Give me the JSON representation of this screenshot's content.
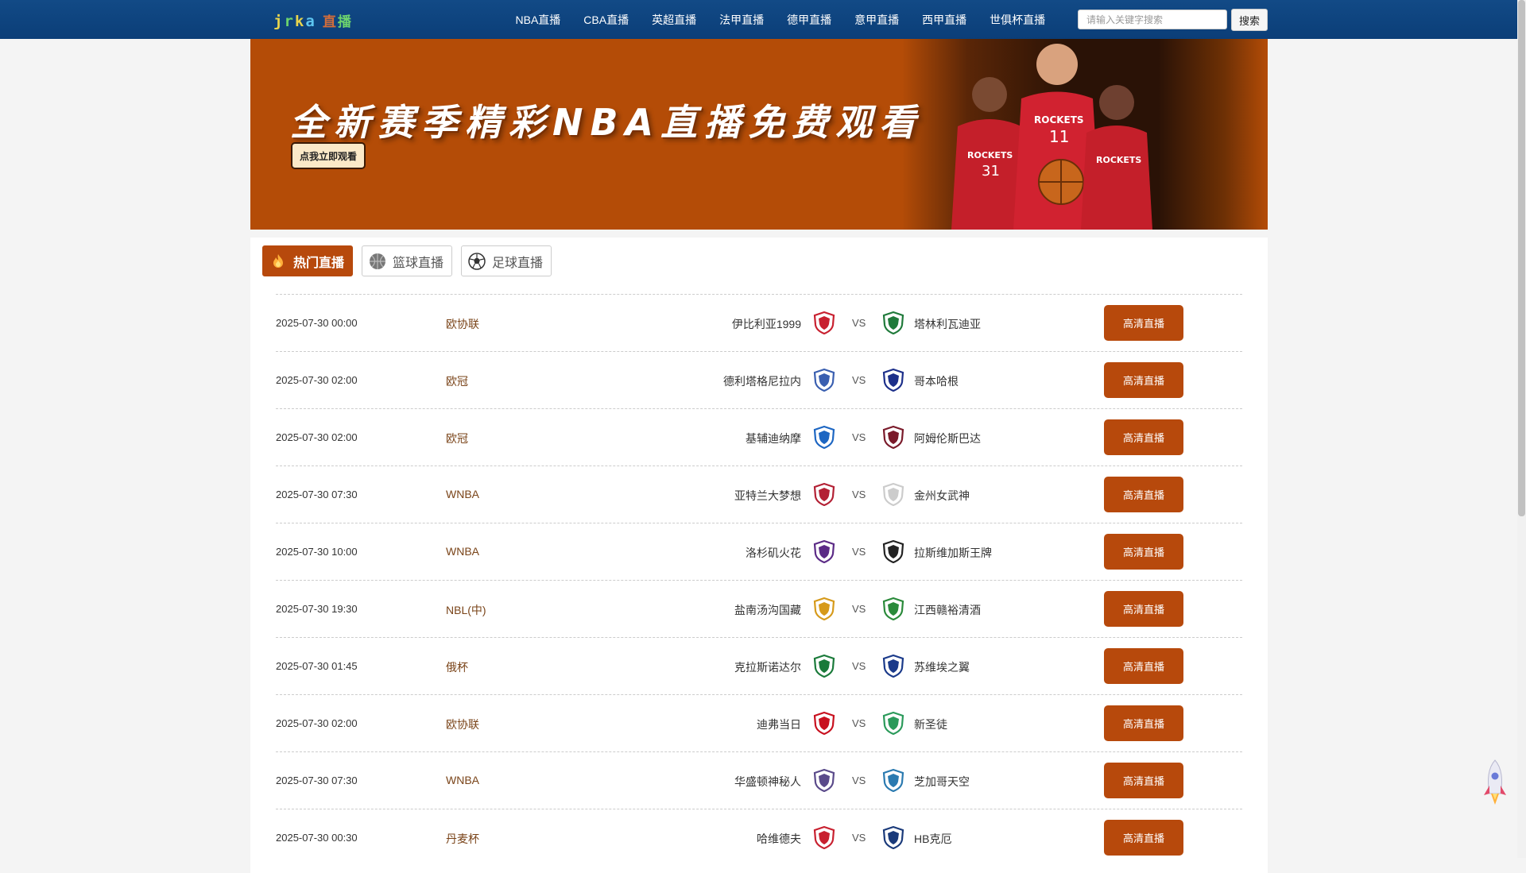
{
  "nav": {
    "logo_text": "jrkan",
    "logo_text_cn": "直播",
    "links": [
      "NBA直播",
      "CBA直播",
      "英超直播",
      "法甲直播",
      "德甲直播",
      "意甲直播",
      "西甲直播",
      "世俱杯直播"
    ],
    "search_placeholder": "请输入关键字搜索",
    "search_button": "搜索"
  },
  "banner": {
    "headline": "全新赛季精彩NBA直播免费观看",
    "cta": "点我立即观看",
    "jersey_texts": [
      "ROCKETS",
      "11",
      "ROCKETS",
      "31",
      "ROCKETS"
    ]
  },
  "tabs": [
    {
      "label": "热门直播",
      "icon": "fire-icon",
      "active": true
    },
    {
      "label": "篮球直播",
      "icon": "basketball-icon",
      "active": false
    },
    {
      "label": "足球直播",
      "icon": "soccer-ball-icon",
      "active": false
    }
  ],
  "matches": [
    {
      "time": "2025-07-30 00:00",
      "league": "欧协联",
      "home": "伊比利亚1999",
      "vs": "VS",
      "away": "塔林利瓦迪亚",
      "button": "高清直播",
      "home_color": "#c8202f",
      "away_color": "#1f7a3a"
    },
    {
      "time": "2025-07-30 02:00",
      "league": "欧冠",
      "home": "德利塔格尼拉内",
      "vs": "VS",
      "away": "哥本哈根",
      "button": "高清直播",
      "home_color": "#3a5fb0",
      "away_color": "#1c2f8a"
    },
    {
      "time": "2025-07-30 02:00",
      "league": "欧冠",
      "home": "基辅迪纳摩",
      "vs": "VS",
      "away": "阿姆伦斯巴达",
      "button": "高清直播",
      "home_color": "#1d66c2",
      "away_color": "#7a1a2a"
    },
    {
      "time": "2025-07-30 07:30",
      "league": "WNBA",
      "home": "亚特兰大梦想",
      "vs": "VS",
      "away": "金州女武神",
      "button": "高清直播",
      "home_color": "#b32034",
      "away_color": "#cccccc"
    },
    {
      "time": "2025-07-30 10:00",
      "league": "WNBA",
      "home": "洛杉矶火花",
      "vs": "VS",
      "away": "拉斯维加斯王牌",
      "button": "高清直播",
      "home_color": "#5b2a86",
      "away_color": "#222222"
    },
    {
      "time": "2025-07-30 19:30",
      "league": "NBL(中)",
      "home": "盐南汤沟国藏",
      "vs": "VS",
      "away": "江西赣裕清酒",
      "button": "高清直播",
      "home_color": "#d69a1a",
      "away_color": "#2a8a3a"
    },
    {
      "time": "2025-07-30 01:45",
      "league": "俄杯",
      "home": "克拉斯诺达尔",
      "vs": "VS",
      "away": "苏维埃之翼",
      "button": "高清直播",
      "home_color": "#1a7a3a",
      "away_color": "#1a3a8a"
    },
    {
      "time": "2025-07-30 02:00",
      "league": "欧协联",
      "home": "迪弗当日",
      "vs": "VS",
      "away": "新圣徒",
      "button": "高清直播",
      "home_color": "#c8101e",
      "away_color": "#2a9a5a"
    },
    {
      "time": "2025-07-30 07:30",
      "league": "WNBA",
      "home": "华盛顿神秘人",
      "vs": "VS",
      "away": "芝加哥天空",
      "button": "高清直播",
      "home_color": "#5a4a8a",
      "away_color": "#2a7ab0"
    },
    {
      "time": "2025-07-30 00:30",
      "league": "丹麦杯",
      "home": "哈维德夫",
      "vs": "VS",
      "away": "HB克厄",
      "button": "高清直播",
      "home_color": "#c8202f",
      "away_color": "#1a3a7a"
    }
  ]
}
